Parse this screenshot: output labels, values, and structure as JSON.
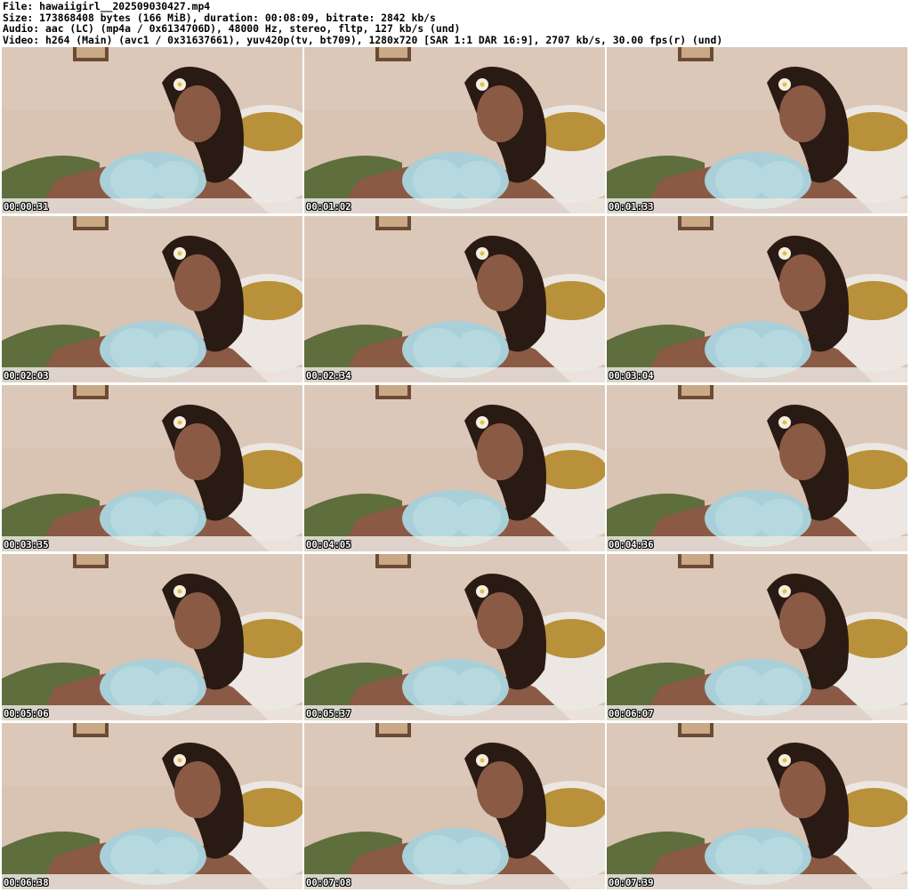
{
  "header": {
    "lines": [
      "File: hawaiigirl__202509030427.mp4",
      "Size: 173868408 bytes (166 MiB), duration: 00:08:09, bitrate: 2842 kb/s",
      "Audio: aac (LC) (mp4a / 0x6134706D), 48000 Hz, stereo, fltp, 127 kb/s (und)",
      "Video: h264 (Main) (avc1 / 0x31637661), yuv420p(tv, bt709), 1280x720 [SAR 1:1 DAR 16:9], 2707 kb/s, 30.00 fps(r) (und)"
    ]
  },
  "thumbnails": [
    {
      "timestamp": "00:00:31"
    },
    {
      "timestamp": "00:01:02"
    },
    {
      "timestamp": "00:01:33"
    },
    {
      "timestamp": "00:02:03"
    },
    {
      "timestamp": "00:02:34"
    },
    {
      "timestamp": "00:03:04"
    },
    {
      "timestamp": "00:03:35"
    },
    {
      "timestamp": "00:04:05"
    },
    {
      "timestamp": "00:04:36"
    },
    {
      "timestamp": "00:05:06"
    },
    {
      "timestamp": "00:05:37"
    },
    {
      "timestamp": "00:06:07"
    },
    {
      "timestamp": "00:06:38"
    },
    {
      "timestamp": "00:07:08"
    },
    {
      "timestamp": "00:07:39"
    }
  ],
  "colors": {
    "wall": "#d9c3b2",
    "pillow_white": "#ece7e2",
    "pillow_gold": "#b8913a",
    "blanket_green": "#5e6e3c",
    "top_light_blue": "#a9cfd8",
    "skin": "#8a5a44",
    "hair": "#2a1a14",
    "flower": "#f4efe0",
    "timestamp_text": "#ffffff"
  },
  "icons": {
    "thumbnail_scene": "video-frame-icon"
  }
}
